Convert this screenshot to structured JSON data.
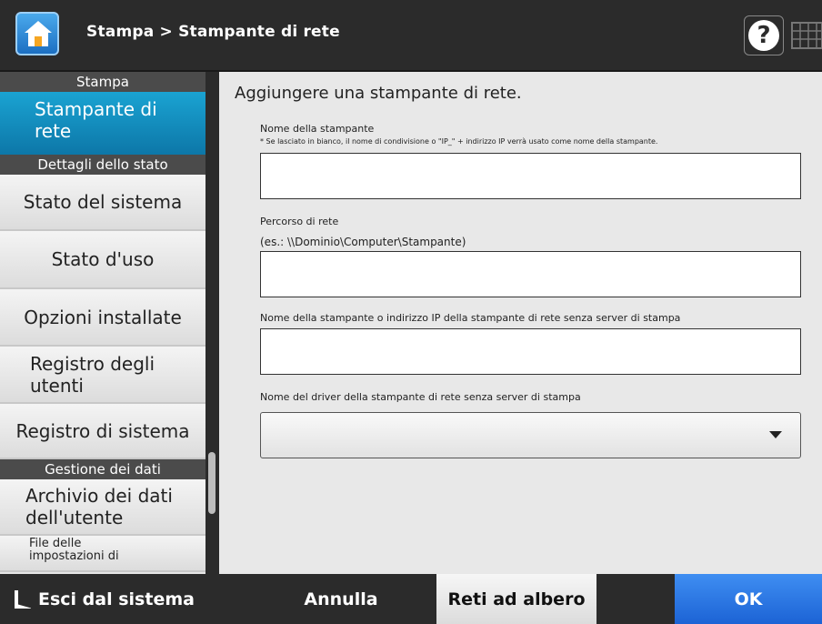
{
  "header": {
    "breadcrumb": "Stampa > Stampante di rete",
    "help_label": "?"
  },
  "sidebar": {
    "section_print": "Stampa",
    "item_network_printer": "Stampante di rete",
    "section_status": "Dettagli dello stato",
    "item_system_status": "Stato del sistema",
    "item_usage_status": "Stato d'uso",
    "item_installed_options": "Opzioni installate",
    "item_user_log": "Registro degli utenti",
    "item_system_log": "Registro di sistema",
    "section_data": "Gestione dei dati",
    "item_user_data_archive": "Archivio dei dati dell'utente",
    "item_settings_files": "File delle impostazioni di"
  },
  "main": {
    "title": "Aggiungere una stampante di rete.",
    "printer_name_label": "Nome della stampante",
    "printer_name_note": "* Se lasciato in bianco, il nome di condivisione o \"IP_\" + indirizzo IP verrà usato come nome della stampante.",
    "printer_name_value": "",
    "network_path_label": "Percorso di rete",
    "network_path_example": "(es.: \\\\Dominio\\Computer\\Stampante)",
    "network_path_value": "",
    "ip_label": "Nome della stampante o indirizzo IP della stampante di rete senza server di stampa",
    "ip_value": "",
    "driver_label": "Nome del driver della stampante di rete senza server di stampa",
    "driver_value": ""
  },
  "footer": {
    "logout_label": "Esci dal sistema",
    "cancel_label": "Annulla",
    "tree_label": "Reti ad albero",
    "ok_label": "OK"
  }
}
